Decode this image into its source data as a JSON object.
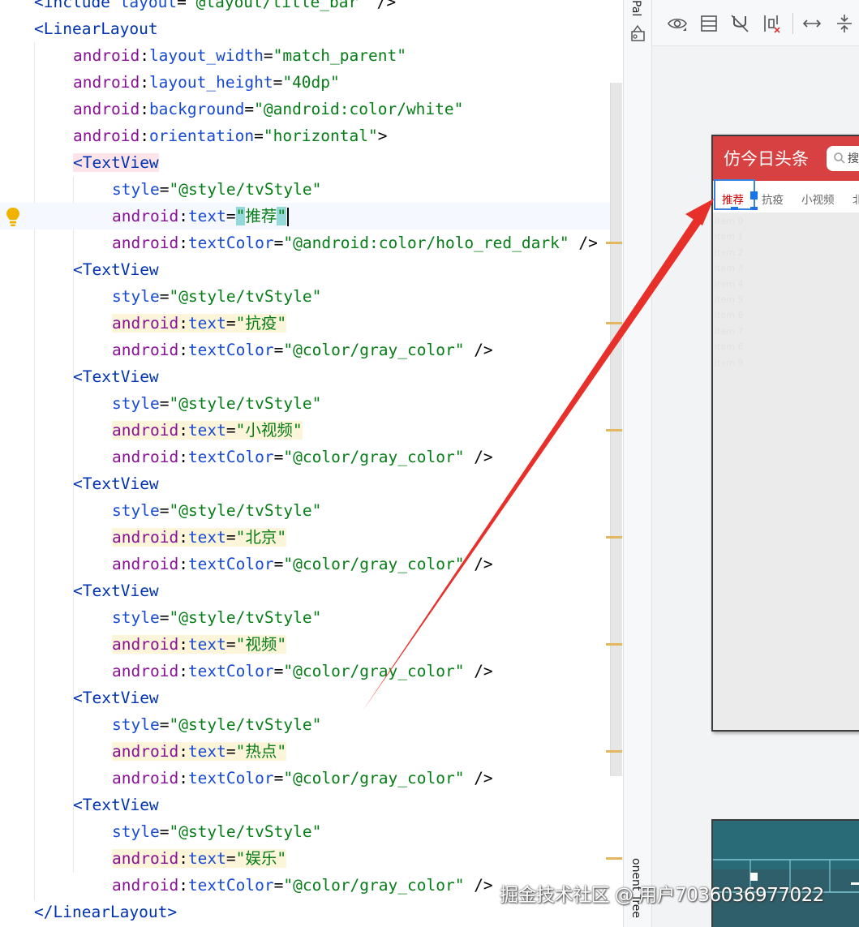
{
  "editor": {
    "lines": [
      {
        "indent": 1,
        "type": "open_close",
        "tag": "include",
        "attr_ns": "layout",
        "attr_name": "",
        "value": "@layout/title_bar",
        "suffix": " />",
        "partial": true
      },
      {
        "indent": 1,
        "type": "tag_open",
        "tag": "LinearLayout"
      },
      {
        "indent": 2,
        "type": "attr",
        "ns": "android",
        "name": "layout_width",
        "value": "match_parent"
      },
      {
        "indent": 2,
        "type": "attr",
        "ns": "android",
        "name": "layout_height",
        "value": "40dp"
      },
      {
        "indent": 2,
        "type": "attr",
        "ns": "android",
        "name": "background",
        "value": "@android:color/white"
      },
      {
        "indent": 2,
        "type": "attr",
        "ns": "android",
        "name": "orientation",
        "value": "horizontal",
        "suffix": ">"
      },
      {
        "indent": 2,
        "type": "tag_open",
        "tag": "TextView",
        "highlight": true
      },
      {
        "indent": 3,
        "type": "attr",
        "ns": "",
        "name": "style",
        "value": "@style/tvStyle"
      },
      {
        "indent": 3,
        "type": "attr",
        "ns": "android",
        "name": "text",
        "value": "推荐",
        "current": true,
        "match": true
      },
      {
        "indent": 3,
        "type": "attr",
        "ns": "android",
        "name": "textColor",
        "value": "@android:color/holo_red_dark",
        "suffix": " />"
      },
      {
        "indent": 2,
        "type": "tag_open",
        "tag": "TextView"
      },
      {
        "indent": 3,
        "type": "attr",
        "ns": "",
        "name": "style",
        "value": "@style/tvStyle"
      },
      {
        "indent": 3,
        "type": "attr",
        "ns": "android",
        "name": "text",
        "value": "抗疫",
        "warn": true
      },
      {
        "indent": 3,
        "type": "attr",
        "ns": "android",
        "name": "textColor",
        "value": "@color/gray_color",
        "suffix": " />"
      },
      {
        "indent": 2,
        "type": "tag_open",
        "tag": "TextView"
      },
      {
        "indent": 3,
        "type": "attr",
        "ns": "",
        "name": "style",
        "value": "@style/tvStyle"
      },
      {
        "indent": 3,
        "type": "attr",
        "ns": "android",
        "name": "text",
        "value": "小视频",
        "warn": true
      },
      {
        "indent": 3,
        "type": "attr",
        "ns": "android",
        "name": "textColor",
        "value": "@color/gray_color",
        "suffix": " />"
      },
      {
        "indent": 2,
        "type": "tag_open",
        "tag": "TextView"
      },
      {
        "indent": 3,
        "type": "attr",
        "ns": "",
        "name": "style",
        "value": "@style/tvStyle"
      },
      {
        "indent": 3,
        "type": "attr",
        "ns": "android",
        "name": "text",
        "value": "北京",
        "warn": true
      },
      {
        "indent": 3,
        "type": "attr",
        "ns": "android",
        "name": "textColor",
        "value": "@color/gray_color",
        "suffix": " />"
      },
      {
        "indent": 2,
        "type": "tag_open",
        "tag": "TextView"
      },
      {
        "indent": 3,
        "type": "attr",
        "ns": "",
        "name": "style",
        "value": "@style/tvStyle"
      },
      {
        "indent": 3,
        "type": "attr",
        "ns": "android",
        "name": "text",
        "value": "视频",
        "warn": true
      },
      {
        "indent": 3,
        "type": "attr",
        "ns": "android",
        "name": "textColor",
        "value": "@color/gray_color",
        "suffix": " />"
      },
      {
        "indent": 2,
        "type": "tag_open",
        "tag": "TextView"
      },
      {
        "indent": 3,
        "type": "attr",
        "ns": "",
        "name": "style",
        "value": "@style/tvStyle"
      },
      {
        "indent": 3,
        "type": "attr",
        "ns": "android",
        "name": "text",
        "value": "热点",
        "warn": true
      },
      {
        "indent": 3,
        "type": "attr",
        "ns": "android",
        "name": "textColor",
        "value": "@color/gray_color",
        "suffix": " />"
      },
      {
        "indent": 2,
        "type": "tag_open",
        "tag": "TextView"
      },
      {
        "indent": 3,
        "type": "attr",
        "ns": "",
        "name": "style",
        "value": "@style/tvStyle"
      },
      {
        "indent": 3,
        "type": "attr",
        "ns": "android",
        "name": "text",
        "value": "娱乐",
        "warn": true
      },
      {
        "indent": 3,
        "type": "attr",
        "ns": "android",
        "name": "textColor",
        "value": "@color/gray_color",
        "suffix": " />"
      },
      {
        "indent": 1,
        "type": "tag_close",
        "tag": "LinearLayout"
      }
    ]
  },
  "side_strip": {
    "palette_tab": "Pal",
    "component_tree_tab": "onent Tree"
  },
  "toolbar": {
    "icons": [
      "eye-icon",
      "layout-icon",
      "magnet-off-icon",
      "constraint-clear-icon",
      "expand-horizontal-icon",
      "pack-vertical-icon"
    ]
  },
  "phone": {
    "title": "仿今日头条",
    "search_text": "搜",
    "tabs": [
      {
        "label": "推荐",
        "selected": true
      },
      {
        "label": "抗疫"
      },
      {
        "label": "小视频"
      },
      {
        "label": "北"
      }
    ],
    "list_items": [
      "item 0",
      "item 1",
      "item 2",
      "item 3",
      "item 4",
      "item 5",
      "item 6",
      "item 7",
      "item 8",
      "item 9"
    ]
  },
  "watermark": "掘金技术社区 @ 用户7036036977022",
  "colors": {
    "tag": "#0033b3",
    "namespace": "#871094",
    "attribute": "#174ad4",
    "string": "#067d17",
    "title_bar": "#d84141",
    "tab_selected": "#cc0000",
    "annotation_arrow": "#e8302a",
    "selection": "#1a73e8"
  }
}
